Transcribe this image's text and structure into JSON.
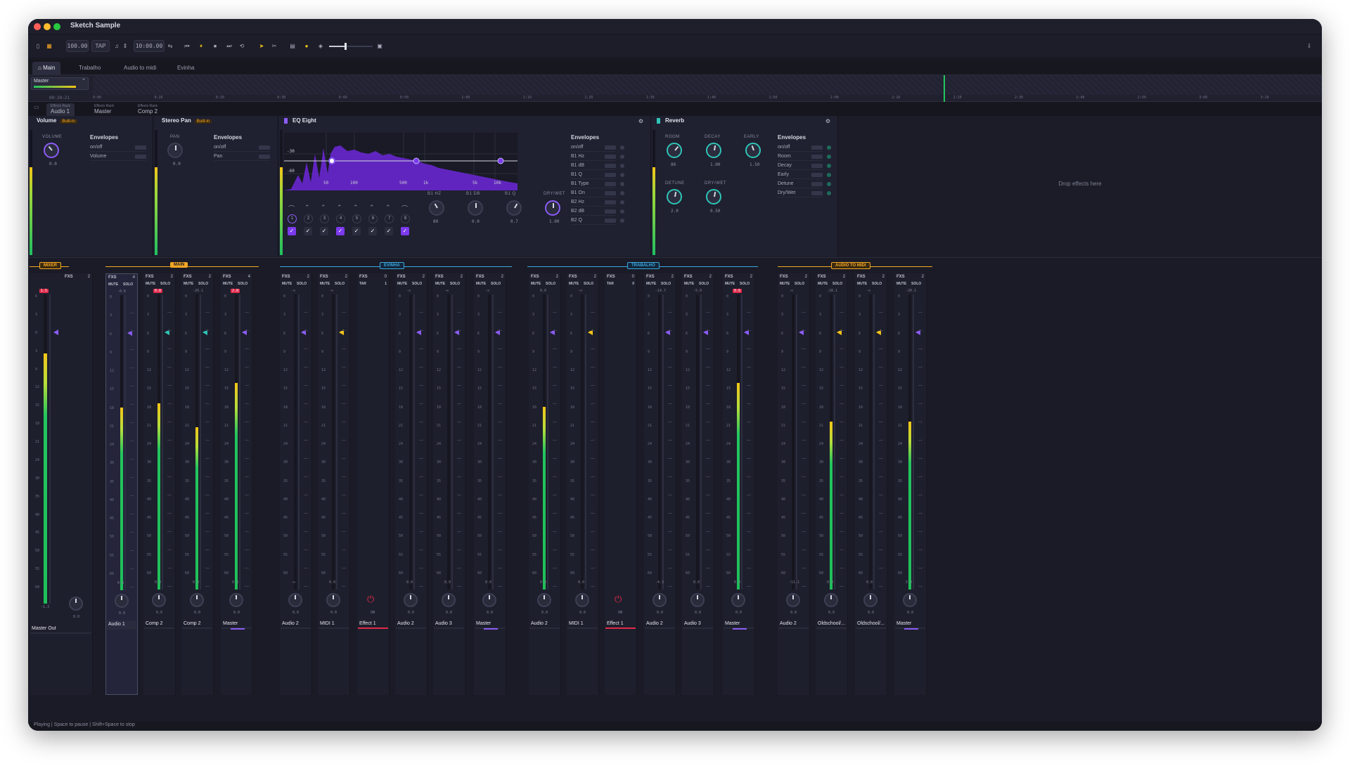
{
  "window": {
    "title": "Sketch Sample"
  },
  "toolbar": {
    "bpm": "100.00",
    "tap": "TAP",
    "time": "10:00.00"
  },
  "tabs": [
    "Main",
    "Trabalho",
    "Audio to midi",
    "Evinha"
  ],
  "arrangement": {
    "track": "Master",
    "time": "00:20:21",
    "ticks": [
      "0:00",
      "0:10",
      "0:20",
      "0:30",
      "0:40",
      "0:50",
      "1:00",
      "1:10",
      "1:20",
      "1:30",
      "1:40",
      "1:50",
      "2:00",
      "2:10",
      "2:20",
      "2:30",
      "2:40",
      "2:50",
      "3:00",
      "3:10"
    ]
  },
  "rack_tabs": [
    {
      "kind": "Effects Rack",
      "name": "Audio 1"
    },
    {
      "kind": "Effects Rack",
      "name": "Master"
    },
    {
      "kind": "Effects Rack",
      "name": "Comp 2"
    }
  ],
  "devices": {
    "volume": {
      "title": "Volume",
      "badge": "Built-in",
      "knob_label": "VOLUME",
      "value": "0.0",
      "envelopes": "Envelopes",
      "env": [
        "on/off",
        "Volume"
      ]
    },
    "pan": {
      "title": "Stereo Pan",
      "badge": "Built-in",
      "knob_label": "PAN",
      "value": "0.0",
      "envelopes": "Envelopes",
      "env": [
        "on/off",
        "Pan"
      ]
    },
    "eq": {
      "title": "EQ Eight",
      "freq_labels": [
        "50",
        "100",
        "500",
        "1k",
        "5k",
        "10k"
      ],
      "db_labels": [
        "-30",
        "-60"
      ],
      "bands": [
        "1",
        "2",
        "3",
        "4",
        "5",
        "6",
        "7",
        "8"
      ],
      "knobs": [
        {
          "label": "B1 HZ",
          "value": "80"
        },
        {
          "label": "B1 DB",
          "value": "0.0"
        },
        {
          "label": "B1 Q",
          "value": "0.7"
        },
        {
          "label": "DRY/WET",
          "value": "1.00"
        }
      ],
      "envelopes": "Envelopes",
      "env": [
        "on/off",
        "B1 Hz",
        "B1 dB",
        "B1 Q",
        "B1 Type",
        "B1 On",
        "B2 Hz",
        "B2 dB",
        "B2 Q"
      ]
    },
    "reverb": {
      "title": "Reverb",
      "knobs": [
        {
          "label": "ROOM",
          "value": "80"
        },
        {
          "label": "DECAY",
          "value": "1.00"
        },
        {
          "label": "EARLY",
          "value": "1.50"
        },
        {
          "label": "DETUNE",
          "value": "2.0"
        },
        {
          "label": "DRY/WET",
          "value": "0.50"
        }
      ],
      "envelopes": "Envelopes",
      "env": [
        "on/off",
        "Room",
        "Decay",
        "Early",
        "Detune",
        "Dry/Wet"
      ]
    },
    "drop": "Drop effects here"
  },
  "groups": [
    {
      "name": "MIXER",
      "color": "#f5a623"
    },
    {
      "name": "MAIN",
      "color": "#f5a623"
    },
    {
      "name": "EVINHA",
      "color": "#3ba7e0"
    },
    {
      "name": "TRABALHO",
      "color": "#3ba7e0"
    },
    {
      "name": "AUDIO TO MIDI",
      "color": "#f5a623"
    }
  ],
  "scale": [
    "0",
    "3",
    "6",
    "9",
    "12",
    "15",
    "18",
    "21",
    "24",
    "30",
    "35",
    "40",
    "45",
    "50",
    "55",
    "60"
  ],
  "master_scale": [
    "6",
    "3",
    "0",
    "3",
    "9",
    "12",
    "15",
    "18",
    "21",
    "24",
    "30",
    "35",
    "40",
    "45",
    "50",
    "55",
    "60"
  ],
  "master": {
    "name": "Master Out",
    "peak": "1.5",
    "val": "-1.3",
    "fxs": "FXS",
    "fxn": "2",
    "knob": "0.0"
  },
  "labels": {
    "fxs": "FXS",
    "mute": "MUTE",
    "solo": "SOLO",
    "tar": "TAR",
    "on": "ON"
  },
  "strips": [
    {
      "name": "Audio 1",
      "fx": "4",
      "peak": "-0.6",
      "bot": "0.0",
      "sv": "0.0",
      "level": 0.62,
      "marker": "#8b5cf6",
      "sel": true
    },
    {
      "name": "Comp 2",
      "fx": "2",
      "peak": "0.8",
      "red": true,
      "bot": "0.0",
      "sv": "0.0",
      "level": 0.63,
      "marker": "#2ec4b6"
    },
    {
      "name": "Comp 2",
      "fx": "2",
      "peak": "-20.1",
      "bot": "0.0",
      "sv": "0.0",
      "level": 0.55,
      "marker": "#2ec4b6"
    },
    {
      "name": "Master",
      "fx": "4",
      "peak": "2.8",
      "red": true,
      "bot": "0.0",
      "sv": "0.0",
      "level": 0.7,
      "marker": "#8b5cf6",
      "ul": true
    },
    {
      "name": "Audio 2",
      "fx": "2",
      "peak": "-∞",
      "bot": "-∞",
      "sv": "0.0",
      "level": 0,
      "marker": "#8b5cf6"
    },
    {
      "name": "MIDI 1",
      "fx": "2",
      "peak": "-∞",
      "bot": "0.0",
      "sv": "0.0",
      "level": 0,
      "marker": "#f5c518"
    },
    {
      "name": "Effect 1",
      "fx": "0",
      "tar": "1",
      "effect": true,
      "sv": "ON"
    },
    {
      "name": "Audio 2",
      "fx": "2",
      "peak": "-∞",
      "bot": "0.0",
      "sv": "0.0",
      "level": 0,
      "marker": "#8b5cf6"
    },
    {
      "name": "Audio 3",
      "fx": "2",
      "peak": "-∞",
      "bot": "0.0",
      "sv": "0.0",
      "level": 0,
      "marker": "#8b5cf6"
    },
    {
      "name": "Master",
      "fx": "2",
      "peak": "-∞",
      "bot": "0.0",
      "sv": "0.0",
      "level": 0,
      "marker": "#8b5cf6",
      "ul": true
    },
    {
      "name": "Audio 2",
      "fx": "2",
      "peak": "0.0",
      "bot": "0.0",
      "sv": "0.0",
      "level": 0.62,
      "marker": "#8b5cf6"
    },
    {
      "name": "MIDI 1",
      "fx": "2",
      "peak": "-∞",
      "bot": "0.0",
      "sv": "0.0",
      "level": 0,
      "marker": "#f5c518"
    },
    {
      "name": "Effect 1",
      "fx": "0",
      "tar": "0",
      "effect": true,
      "sv": "ON"
    },
    {
      "name": "Audio 2",
      "fx": "2",
      "peak": "-14.7",
      "bot": "-4.3",
      "sv": "0.0",
      "level": 0,
      "marker": "#8b5cf6"
    },
    {
      "name": "Audio 3",
      "fx": "2",
      "peak": "-5.0",
      "bot": "0.0",
      "sv": "0.0",
      "level": 0,
      "marker": "#8b5cf6"
    },
    {
      "name": "Master",
      "fx": "2",
      "peak": "0.6",
      "red": true,
      "bot": "6.0",
      "sv": "0.0",
      "level": 0.7,
      "marker": "#8b5cf6",
      "ul": true
    },
    {
      "name": "Audio 2",
      "fx": "2",
      "peak": "-∞",
      "bot": "-11.1",
      "sv": "0.0",
      "level": 0,
      "marker": "#8b5cf6"
    },
    {
      "name": "Oldschool/...",
      "fx": "2",
      "peak": "-20.1",
      "bot": "0.0",
      "sv": "0.0",
      "level": 0.57,
      "marker": "#f5c518"
    },
    {
      "name": "Oldschool/...",
      "fx": "2",
      "peak": "-∞",
      "bot": "0.0",
      "sv": "0.0",
      "level": 0,
      "marker": "#f5c518"
    },
    {
      "name": "Master",
      "fx": "2",
      "peak": "-20.1",
      "bot": "5.9",
      "sv": "0.0",
      "level": 0.57,
      "marker": "#8b5cf6",
      "ul": true
    }
  ],
  "status": "Playing | Space to pause | Shift+Space to stop"
}
